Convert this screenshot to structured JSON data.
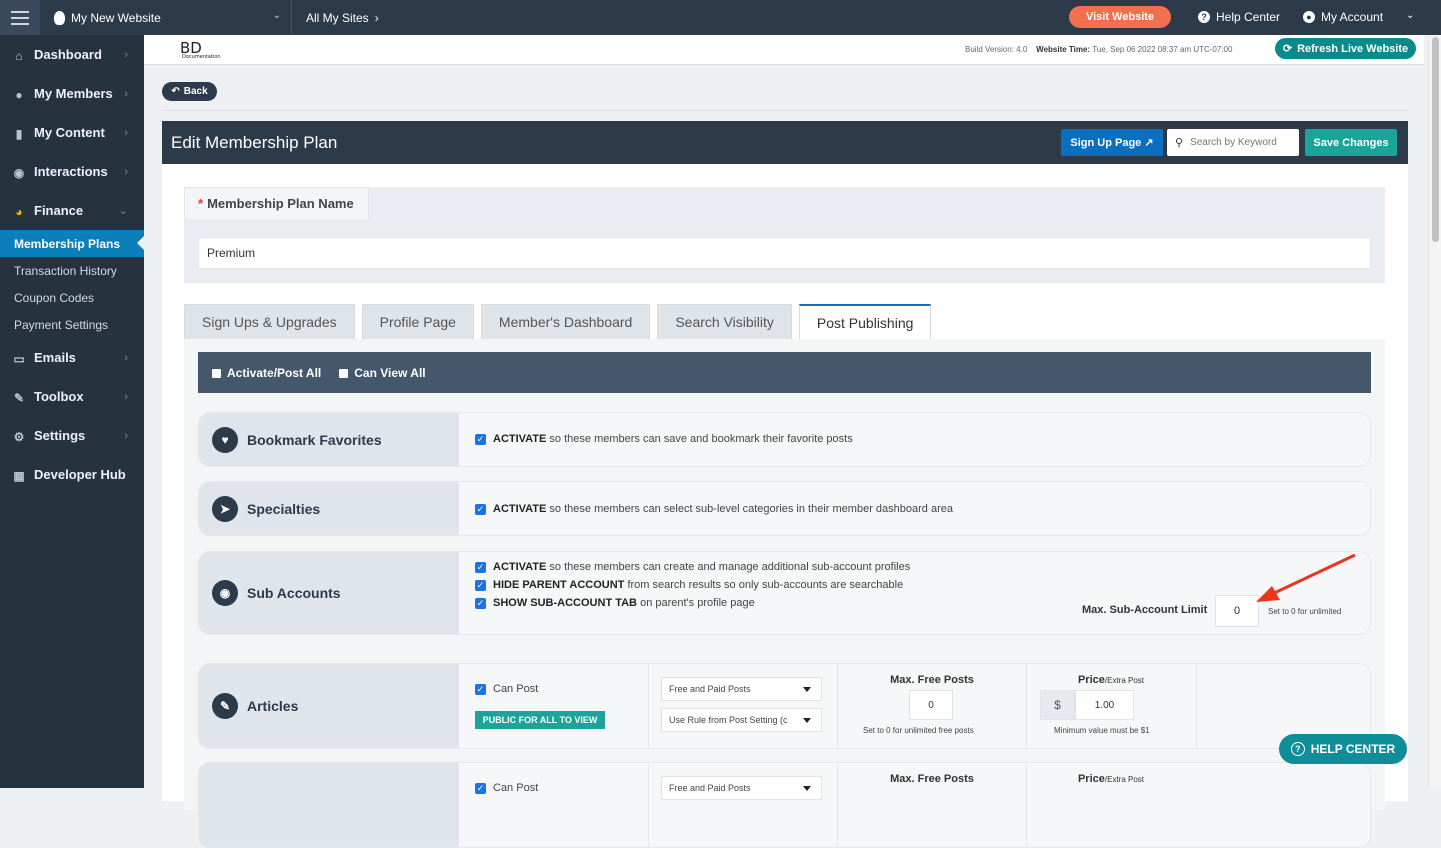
{
  "topbar": {
    "site_name": "My New Website",
    "all_sites": "All My Sites",
    "visit": "Visit Website",
    "help": "Help Center",
    "account": "My Account"
  },
  "sidebar": {
    "items": [
      {
        "label": "Dashboard",
        "icon": "home-icon"
      },
      {
        "label": "My Members",
        "icon": "users-icon"
      },
      {
        "label": "My Content",
        "icon": "folder-icon"
      },
      {
        "label": "Interactions",
        "icon": "comments-icon"
      },
      {
        "label": "Finance",
        "icon": "pie-chart-icon"
      }
    ],
    "finance_sub": [
      "Membership Plans",
      "Transaction History",
      "Coupon Codes",
      "Payment Settings"
    ],
    "items2": [
      {
        "label": "Emails",
        "icon": "inbox-icon"
      },
      {
        "label": "Toolbox",
        "icon": "wrench-icon"
      },
      {
        "label": "Settings",
        "icon": "gear-icon"
      },
      {
        "label": "Developer Hub",
        "icon": "grid-icon"
      }
    ]
  },
  "header": {
    "logo": "BD",
    "logo_sub": "Documentation",
    "build_label": "Build Version:",
    "build_value": "4.0",
    "time_label": "Website Time:",
    "time_value": "Tue, Sep 06 2022 08:37 am UTC-07:00",
    "refresh": "Refresh Live Website"
  },
  "back": "Back",
  "panel": {
    "title": "Edit Membership Plan",
    "signup": "Sign Up Page",
    "search_placeholder": "Search by Keyword",
    "save": "Save Changes"
  },
  "plan": {
    "name_label": "Membership Plan Name",
    "required": "*",
    "name_value": "Premium"
  },
  "tabs": [
    "Sign Ups & Upgrades",
    "Profile Page",
    "Member's Dashboard",
    "Search Visibility",
    "Post Publishing"
  ],
  "bar": {
    "activate_all": "Activate/Post All",
    "view_all": "Can View All"
  },
  "features": {
    "bookmark": {
      "label": "Bookmark Favorites",
      "bold": "ACTIVATE",
      "text": " so these members can save and bookmark their favorite posts"
    },
    "specialties": {
      "label": "Specialties",
      "bold": "ACTIVATE",
      "text": " so these members can select sub-level categories in their member dashboard area"
    },
    "subaccounts": {
      "label": "Sub Accounts",
      "lines": [
        {
          "bold": "ACTIVATE",
          "text": " so these members can create and manage additional sub-account profiles"
        },
        {
          "bold": "HIDE PARENT ACCOUNT",
          "text": " from search results so only sub-accounts are searchable"
        },
        {
          "bold": "SHOW SUB-ACCOUNT TAB",
          "text": " on parent's profile page"
        }
      ],
      "limit_label": "Max. Sub-Account Limit",
      "limit_value": "0",
      "limit_note": "Set to 0 for unlimited"
    },
    "articles": {
      "label": "Articles",
      "can_post": "Can Post",
      "public": "PUBLIC FOR ALL TO VIEW",
      "select1": "Free and Paid Posts",
      "select2": "Use Rule from Post Setting (c",
      "max_free": "Max. Free Posts",
      "max_value": "0",
      "max_note": "Set to 0 for unlimited free posts",
      "price": "Price",
      "price_sub": "/Extra Post",
      "currency": "$",
      "price_value": "1.00",
      "price_note": "Minimum value must be $1"
    },
    "next": {
      "can_post": "Can Post",
      "select1": "Free and Paid Posts",
      "max_free": "Max. Free Posts",
      "price": "Price",
      "price_sub": "/Extra Post"
    }
  },
  "help_center": "HELP CENTER"
}
